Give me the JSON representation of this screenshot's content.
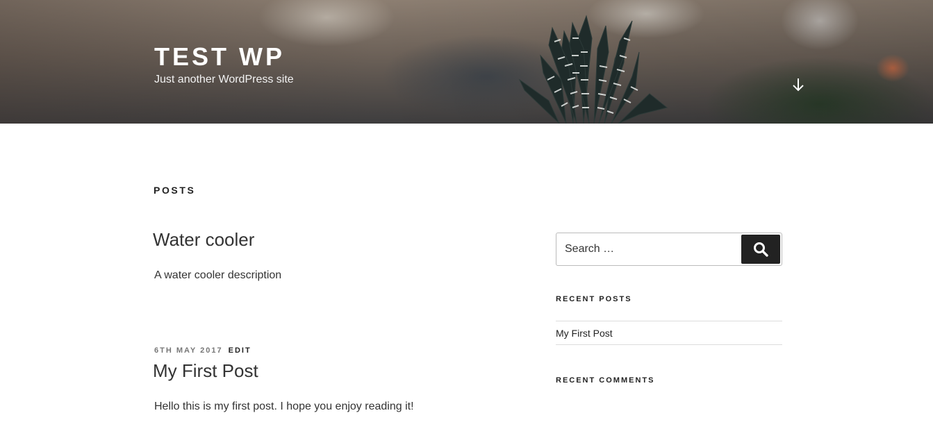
{
  "header": {
    "site_title": "TEST WP",
    "site_description": "Just another WordPress site",
    "scroll_icon": "arrow-down-icon"
  },
  "main": {
    "page_title": "POSTS",
    "posts": [
      {
        "title": "Water cooler",
        "excerpt": "A water cooler description"
      },
      {
        "date": "6TH MAY 2017",
        "edit_label": "EDIT",
        "title": "My First Post",
        "excerpt": "Hello this is my first post. I hope you enjoy reading it!"
      }
    ]
  },
  "sidebar": {
    "search": {
      "placeholder": "Search …",
      "icon": "search-icon"
    },
    "recent_posts": {
      "title": "RECENT POSTS",
      "items": [
        "My First Post"
      ]
    },
    "recent_comments": {
      "title": "RECENT COMMENTS"
    }
  },
  "colors": {
    "text": "#333333",
    "heading": "#222222",
    "meta": "#767676",
    "button": "#222222",
    "border": "#dddddd"
  }
}
